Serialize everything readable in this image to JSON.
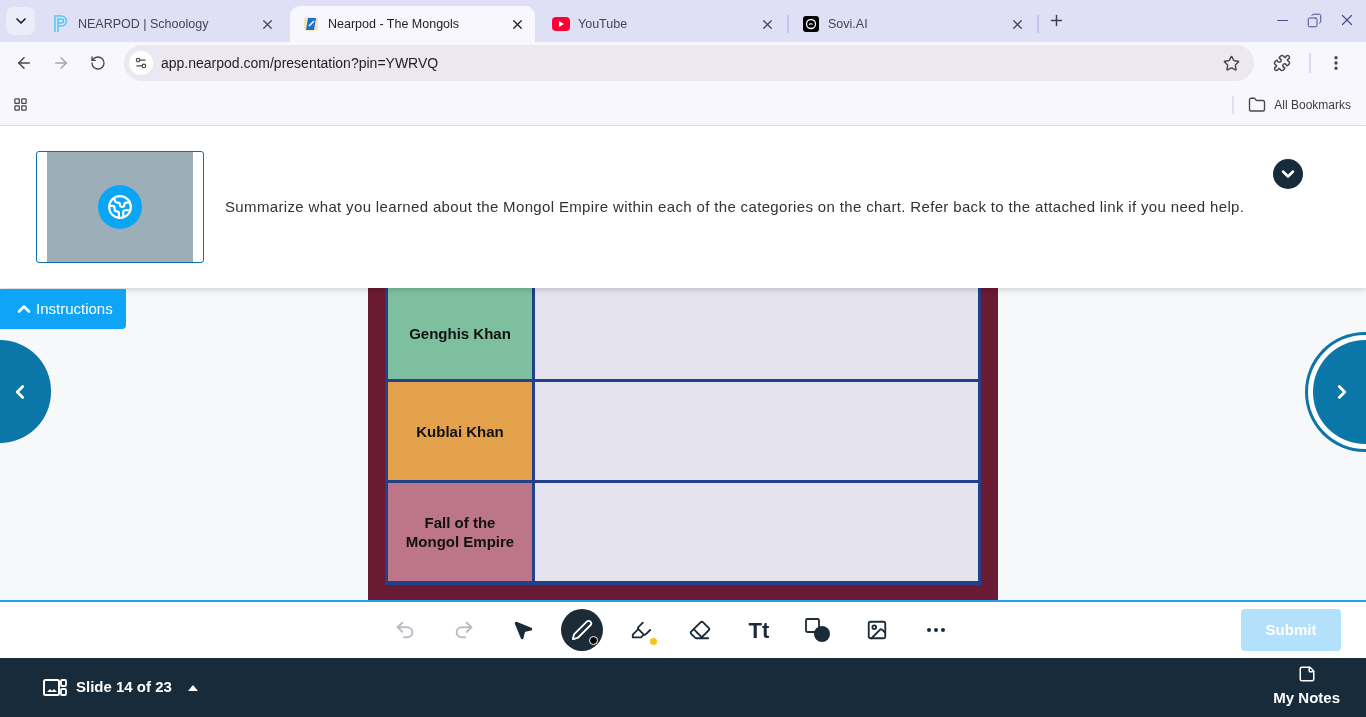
{
  "browser": {
    "tabs": [
      {
        "title": "NEARPOD | Schoology",
        "selected": false
      },
      {
        "title": "Nearpod - The Mongols",
        "selected": true
      },
      {
        "title": "YouTube",
        "selected": false
      },
      {
        "title": "Sovi.AI",
        "selected": false
      }
    ],
    "nav": [
      {
        "kind": "back",
        "disabled": false
      },
      {
        "kind": "forward",
        "disabled": true
      },
      {
        "kind": "reload",
        "disabled": false
      }
    ],
    "address_bar": {
      "url": "app.nearpod.com/presentation?pin=YWRVQ"
    },
    "bookmarks_bar": {
      "all_bookmarks": "All Bookmarks"
    }
  },
  "instructions": {
    "expanded": true,
    "text": "Summarize what you learned about the Mongol Empire within each of the categories on the chart. Refer back to the attached link if you need help.",
    "toggle_label": "Instructions"
  },
  "slide": {
    "rows": [
      {
        "label": "Genghis Khan",
        "color": "#7dbf9f"
      },
      {
        "label": "Kublai Khan",
        "color": "#e2a14a"
      },
      {
        "label": "Fall of the Mongol Empire",
        "color": "#bd7588"
      }
    ]
  },
  "toolbar": {
    "history": [
      {
        "kind": "undo",
        "disabled": true
      },
      {
        "kind": "redo",
        "disabled": true
      }
    ],
    "tools": [
      {
        "kind": "select",
        "selected": false
      },
      {
        "kind": "pen",
        "selected": true,
        "color": "#000000"
      },
      {
        "kind": "highlighter",
        "selected": false,
        "color": "#f5c518"
      },
      {
        "kind": "eraser",
        "selected": false
      },
      {
        "kind": "text",
        "label": "Tt",
        "selected": false
      },
      {
        "kind": "shape",
        "selected": false
      },
      {
        "kind": "image",
        "selected": false
      }
    ],
    "submit": {
      "label": "Submit",
      "disabled": true
    }
  },
  "footer": {
    "slide_counter": "Slide 14 of 23",
    "notes_label": "My Notes"
  }
}
